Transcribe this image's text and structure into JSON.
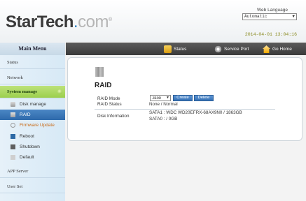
{
  "header": {
    "logo_part1": "StarTech",
    "logo_part2": ".com",
    "logo_mark": "®",
    "web_language_label": "Web Language",
    "web_language_value": "Automatic",
    "datetime": "2014-04-01 13:04:16"
  },
  "topnav": {
    "status": "Status",
    "service_port": "Service Port",
    "go_home": "Go Home"
  },
  "sidebar": {
    "title": "Main Menu",
    "items": {
      "status": "Status",
      "network": "Network",
      "system_manage": "System manage",
      "app_server": "APP Server",
      "user_set": "User Set"
    },
    "sub": {
      "disk_manage": "Disk manage",
      "raid": "RAID",
      "firmware_update": "Firmware Update",
      "reboot": "Reboot",
      "shutdown": "Shutdown",
      "default": "Default"
    }
  },
  "raid": {
    "title": "RAID",
    "mode_label": "RAID Mode",
    "mode_value": "JBOD",
    "create_btn": "Create",
    "delete_btn": "Delete",
    "status_label": "RAID Status",
    "status_value": "None / Normal",
    "disk_info_label": "Disk Information",
    "disk_info_line1": "SATA1 : WDC WD20EFRX-68AX9N0 / 1863GB",
    "disk_info_line2": "SATA0 : / 0GB"
  },
  "colors": {
    "accent_blue": "#2e6aab",
    "active_green": "#9ccf4d",
    "topbar_dark": "#3a3a3a",
    "firmware_orange": "#c86a17"
  }
}
